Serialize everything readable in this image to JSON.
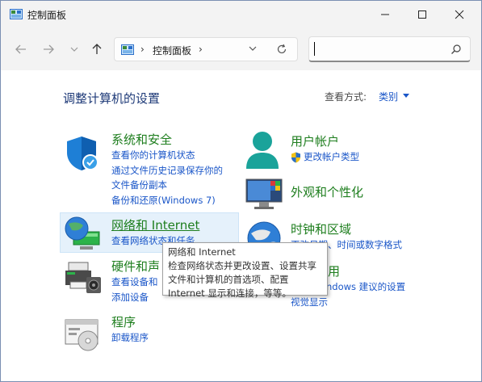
{
  "window": {
    "title": "控制面板"
  },
  "address": {
    "path": "控制面板",
    "separator": "›"
  },
  "search": {
    "value": ""
  },
  "header": {
    "title": "调整计算机的设置",
    "view_by_label": "查看方式:",
    "view_by_value": "类别"
  },
  "categories": [
    {
      "title": "系统和安全",
      "icon": "shield-icon",
      "links": [
        "查看你的计算机状态",
        "通过文件历史记录保存你的",
        "文件备份副本",
        "备份和还原(Windows 7)"
      ]
    },
    {
      "title": "网络和 Internet",
      "icon": "network-globe-icon",
      "links": [
        "查看网络状态和任务"
      ]
    },
    {
      "title": "硬件和声",
      "icon": "printer-icon",
      "links": [
        "查看设备和",
        "添加设备"
      ]
    },
    {
      "title": "程序",
      "icon": "programs-icon",
      "links": [
        "卸载程序"
      ]
    },
    {
      "title": "用户帐户",
      "icon": "user-icon",
      "links": [
        "更改帐户类型"
      ]
    },
    {
      "title": "外观和个性化",
      "icon": "monitor-icon",
      "links": []
    },
    {
      "title": "时钟和区域",
      "icon": "clock-globe-icon",
      "links": [
        "更改日期、时间或数字格式"
      ]
    },
    {
      "title": "用",
      "icon": "ease-of-access-icon",
      "links": [
        "ndows 建议的设置",
        "视觉显示"
      ]
    }
  ],
  "tooltip": {
    "lines": [
      "网络和 Internet",
      "检查网络状态并更改设置、设置共享",
      "文件和计算机的首选项、配置",
      "Internet 显示和连接，等等。"
    ]
  },
  "colors": {
    "category_title": "#1e7e1e",
    "link": "#1a56c8",
    "page_title": "#1e3a78"
  }
}
